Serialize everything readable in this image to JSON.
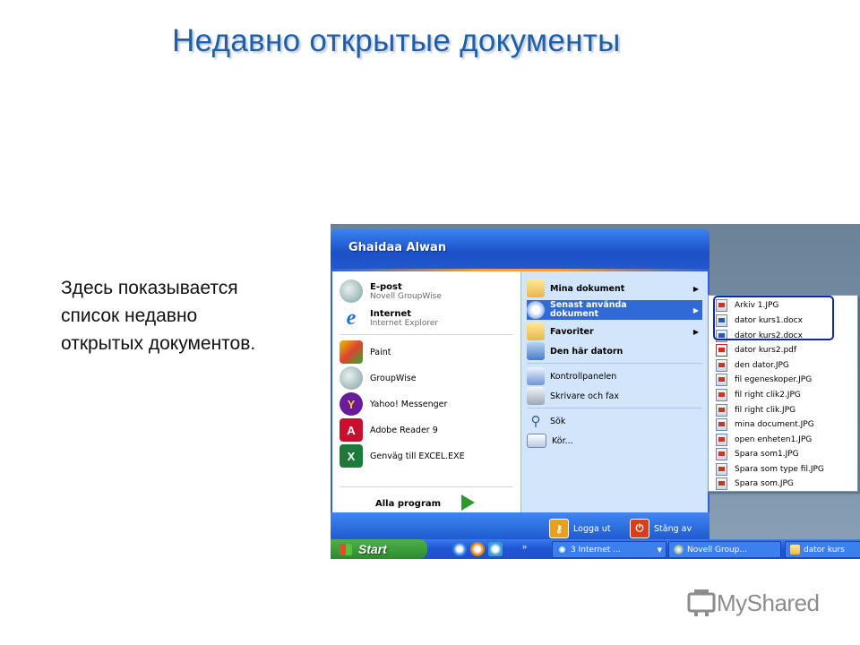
{
  "slide": {
    "title": "Недавно открытые документы",
    "description_lines": [
      "Здесь показывается",
      "список недавно",
      "открытых документов."
    ]
  },
  "start_menu": {
    "user_name": "Ghaidaa Alwan",
    "pinned": [
      {
        "title": "E-post",
        "subtitle": "Novell GroupWise",
        "icon": "groupwise-icon"
      },
      {
        "title": "Internet",
        "subtitle": "Internet Explorer",
        "icon": "internet-explorer-icon"
      }
    ],
    "recent_programs": [
      {
        "label": "Paint",
        "icon": "paint-icon"
      },
      {
        "label": "GroupWise",
        "icon": "groupwise-icon"
      },
      {
        "label": "Yahoo! Messenger",
        "icon": "yahoo-messenger-icon"
      },
      {
        "label": "Adobe Reader 9",
        "icon": "adobe-reader-icon"
      },
      {
        "label": "Genväg till EXCEL.EXE",
        "icon": "excel-icon"
      }
    ],
    "all_programs": "Alla program",
    "right_items": [
      {
        "label": "Mina dokument",
        "bold": true,
        "submenu": true,
        "icon": "my-documents-icon"
      },
      {
        "label": "Senast använda dokument",
        "bold": true,
        "submenu": true,
        "selected": true,
        "icon": "recent-documents-icon"
      },
      {
        "label": "Favoriter",
        "bold": true,
        "submenu": true,
        "icon": "favorites-folder-icon"
      },
      {
        "label": "Den här datorn",
        "bold": true,
        "submenu": false,
        "icon": "my-computer-icon"
      },
      {
        "label": "Kontrollpanelen",
        "bold": false,
        "submenu": false,
        "icon": "control-panel-icon"
      },
      {
        "label": "Skrivare och fax",
        "bold": false,
        "submenu": false,
        "icon": "printer-icon"
      },
      {
        "label": "Sök",
        "bold": false,
        "submenu": false,
        "icon": "search-icon"
      },
      {
        "label": "Kör...",
        "bold": false,
        "submenu": false,
        "icon": "run-icon"
      }
    ],
    "footer": {
      "logoff": "Logga ut",
      "shutdown": "Stäng av"
    }
  },
  "recent_documents": [
    {
      "name": "Arkiv 1.JPG",
      "type": "jpg"
    },
    {
      "name": "dator kurs1.docx",
      "type": "doc"
    },
    {
      "name": "dator kurs2.docx",
      "type": "doc"
    },
    {
      "name": "dator kurs2.pdf",
      "type": "pdf"
    },
    {
      "name": "den dator.JPG",
      "type": "jpg"
    },
    {
      "name": "fil egeneskoper.JPG",
      "type": "jpg"
    },
    {
      "name": "fil right clik2.JPG",
      "type": "jpg"
    },
    {
      "name": "fil right clik.JPG",
      "type": "jpg"
    },
    {
      "name": "mina document.JPG",
      "type": "jpg"
    },
    {
      "name": "open enheten1.JPG",
      "type": "jpg"
    },
    {
      "name": "Spara som1.JPG",
      "type": "jpg"
    },
    {
      "name": "Spara som type fil.JPG",
      "type": "jpg"
    },
    {
      "name": "Spara som.JPG",
      "type": "jpg"
    }
  ],
  "taskbar": {
    "start": "Start",
    "tasks": [
      "3 Internet ...",
      "Novell Group...",
      "dator kurs"
    ]
  },
  "watermark": "MyShared",
  "colors": {
    "title": "#1f5fa8",
    "xp_blue": "#2a64d8",
    "highlight_border": "#1126a8",
    "arrow_fill": "#4472c4"
  }
}
